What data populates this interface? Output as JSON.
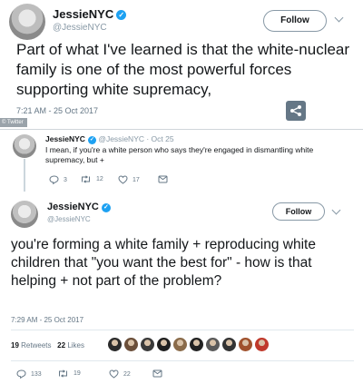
{
  "tweet1": {
    "display_name": "JessieNYC",
    "handle": "@JessieNYC",
    "follow_label": "Follow",
    "text": "Part of what I've learned is that the white-nuclear family is one of the most powerful forces supporting white supremacy,",
    "timestamp": "7:21 AM - 25 Oct 2017",
    "credit": "© Twitter"
  },
  "reply_context": {
    "display_name": "JessieNYC",
    "meta": "@JessieNYC · Oct 25",
    "text": "I mean, if you're a white person who says they're engaged in dismantling white supremacy, but +",
    "replies": "3",
    "retweets": "12",
    "likes": "17"
  },
  "tweet2": {
    "display_name": "JessieNYC",
    "handle": "@JessieNYC",
    "follow_label": "Follow",
    "text": "you're forming a white family + reproducing white children that \"you want the best for\" - how is that helping + not part of the problem?",
    "timestamp": "7:29 AM - 25 Oct 2017",
    "retweet_count": "19",
    "retweet_label": "Retweets",
    "like_count": "22",
    "like_label": "Likes",
    "replies": "133",
    "retweets": "19",
    "likes": "22"
  },
  "liker_colors": [
    "#2b2b2b",
    "#6b4f3a",
    "#3a3a3a",
    "#1f1f1f",
    "#8a6b4a",
    "#222222",
    "#5a5a5a",
    "#333333",
    "#a0522d",
    "#c0392b"
  ],
  "colors": {
    "verified": "#1da1f2",
    "secondary_text": "#657786",
    "border": "#8899a6"
  }
}
